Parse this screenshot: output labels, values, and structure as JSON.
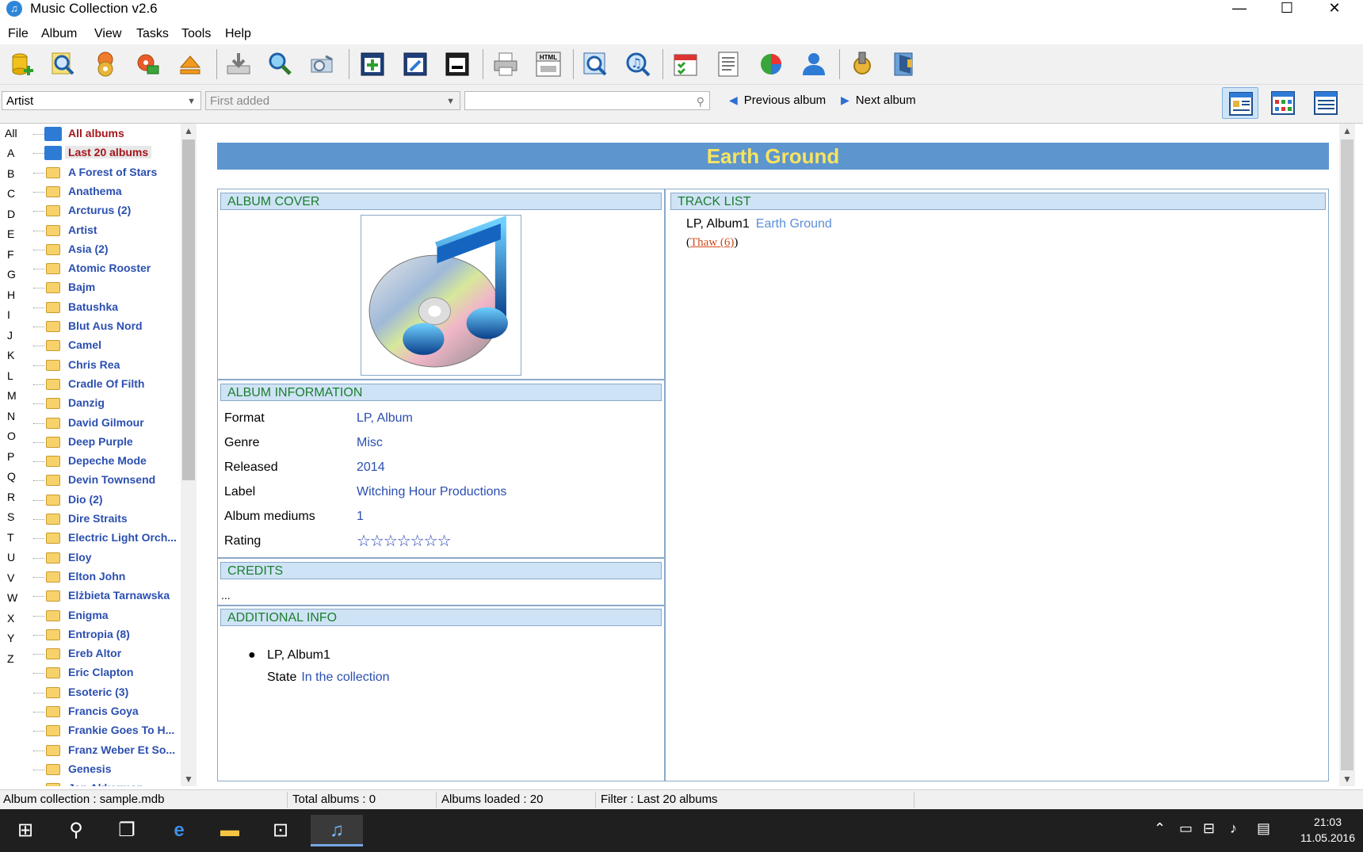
{
  "window": {
    "title": "Music Collection v2.6",
    "minimize": "—",
    "maximize": "☐",
    "close": "✕"
  },
  "menu": [
    "File",
    "Album",
    "View",
    "Tasks",
    "Tools",
    "Help"
  ],
  "toolbar": {
    "icons": [
      "add-album-icon",
      "find-icon",
      "discs-icon",
      "discs-edit-icon",
      "eject-icon",
      "import-icon",
      "search-web-icon",
      "scan-icon",
      "new-album-icon",
      "edit-album-icon",
      "delete-album-icon",
      "print-icon",
      "html-export-icon",
      "preview-icon",
      "music-search-icon",
      "calendar-icon",
      "report-icon",
      "statistics-pie-icon",
      "users-icon",
      "settings-icon",
      "exit-icon"
    ],
    "html_label": "HTML"
  },
  "filterbar": {
    "group_by": "Artist",
    "sort_by": "First added",
    "search_value": "",
    "previous_album": "Previous album",
    "next_album": "Next album"
  },
  "alphabet": [
    "All",
    "A",
    "B",
    "C",
    "D",
    "E",
    "F",
    "G",
    "H",
    "I",
    "J",
    "K",
    "L",
    "M",
    "N",
    "O",
    "P",
    "Q",
    "R",
    "S",
    "T",
    "U",
    "V",
    "W",
    "X",
    "Y",
    "Z"
  ],
  "tree": [
    {
      "label": "All albums",
      "type": "collection",
      "red": true
    },
    {
      "label": "Last 20 albums",
      "type": "collection",
      "red": true,
      "selected": true
    },
    {
      "label": "A Forest of Stars",
      "type": "folder"
    },
    {
      "label": "Anathema",
      "type": "folder"
    },
    {
      "label": "Arcturus (2)",
      "type": "folder"
    },
    {
      "label": "Artist",
      "type": "folder"
    },
    {
      "label": "Asia (2)",
      "type": "folder"
    },
    {
      "label": "Atomic Rooster",
      "type": "folder"
    },
    {
      "label": "Bajm",
      "type": "folder"
    },
    {
      "label": "Batushka",
      "type": "folder"
    },
    {
      "label": "Blut Aus Nord",
      "type": "folder"
    },
    {
      "label": "Camel",
      "type": "folder"
    },
    {
      "label": "Chris Rea",
      "type": "folder"
    },
    {
      "label": "Cradle Of Filth",
      "type": "folder"
    },
    {
      "label": "Danzig",
      "type": "folder"
    },
    {
      "label": "David Gilmour",
      "type": "folder"
    },
    {
      "label": "Deep Purple",
      "type": "folder"
    },
    {
      "label": "Depeche Mode",
      "type": "folder"
    },
    {
      "label": "Devin Townsend",
      "type": "folder"
    },
    {
      "label": "Dio (2)",
      "type": "folder"
    },
    {
      "label": "Dire Straits",
      "type": "folder"
    },
    {
      "label": "Electric Light Orch...",
      "type": "folder"
    },
    {
      "label": "Eloy",
      "type": "folder"
    },
    {
      "label": "Elton John",
      "type": "folder"
    },
    {
      "label": "Elżbieta Tarnawska",
      "type": "folder"
    },
    {
      "label": "Enigma",
      "type": "folder"
    },
    {
      "label": "Entropia (8)",
      "type": "folder"
    },
    {
      "label": "Ereb Altor",
      "type": "folder"
    },
    {
      "label": "Eric Clapton",
      "type": "folder"
    },
    {
      "label": "Esoteric (3)",
      "type": "folder"
    },
    {
      "label": "Francis Goya",
      "type": "folder"
    },
    {
      "label": "Frankie Goes To H...",
      "type": "folder"
    },
    {
      "label": "Franz Weber Et So...",
      "type": "folder"
    },
    {
      "label": "Genesis",
      "type": "folder"
    },
    {
      "label": "Jan Akkerman",
      "type": "folder"
    }
  ],
  "album": {
    "title": "Earth Ground",
    "sections": {
      "cover": "ALBUM COVER",
      "info": "ALBUM INFORMATION",
      "credits": "CREDITS",
      "additional": "ADDITIONAL INFO",
      "tracks": "TRACK LIST"
    },
    "info": [
      {
        "key": "Format",
        "value": "LP, Album"
      },
      {
        "key": "Genre",
        "value": "Misc"
      },
      {
        "key": "Released",
        "value": "2014"
      },
      {
        "key": "Label",
        "value": "Witching Hour Productions"
      },
      {
        "key": "Album mediums",
        "value": "1"
      }
    ],
    "rating_label": "Rating",
    "rating_stars": "☆☆☆☆☆☆☆",
    "credits_text": "...",
    "additional": {
      "medium": "LP, Album1",
      "state_label": "State",
      "state_value": "In the collection"
    },
    "tracklist": {
      "medium": "LP, Album1",
      "album": "Earth Ground",
      "open": "(",
      "link": "Thaw (6)",
      "close": ")"
    }
  },
  "status": {
    "collection": "Album collection : sample.mdb",
    "total": "Total albums : 0",
    "loaded": "Albums loaded : 20",
    "filter": "Filter : Last 20 albums"
  },
  "taskbar": {
    "time": "21:03",
    "date": "11.05.2016"
  },
  "colors": {
    "heading_bg": "#5d95cf",
    "heading_text": "#f7e45f",
    "section_text": "#1b7f2d",
    "value_text": "#2b4fb0"
  }
}
